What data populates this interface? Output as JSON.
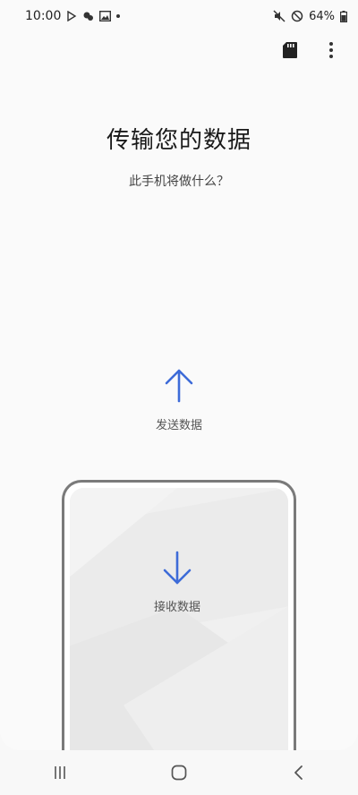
{
  "status_bar": {
    "time": "10:00",
    "battery": "64%",
    "left_icons": [
      "play-store-icon",
      "weather-icon",
      "gallery-icon",
      "dot-icon"
    ],
    "right_icons": [
      "mute-icon",
      "do-not-disturb-icon",
      "battery-icon"
    ]
  },
  "header": {
    "actions": [
      "sd-card-icon",
      "more-options-icon"
    ]
  },
  "main": {
    "title": "传输您的数据",
    "subtitle": "此手机将做什么？",
    "send": {
      "label": "发送数据",
      "icon": "arrow-up-icon"
    },
    "receive": {
      "label": "接收数据",
      "icon": "arrow-down-icon"
    }
  },
  "nav": {
    "buttons": [
      "recent-apps-icon",
      "home-icon",
      "back-icon"
    ]
  },
  "colors": {
    "accent": "#3d6bd8",
    "text_primary": "#1a1a1a",
    "text_secondary": "#555555"
  }
}
